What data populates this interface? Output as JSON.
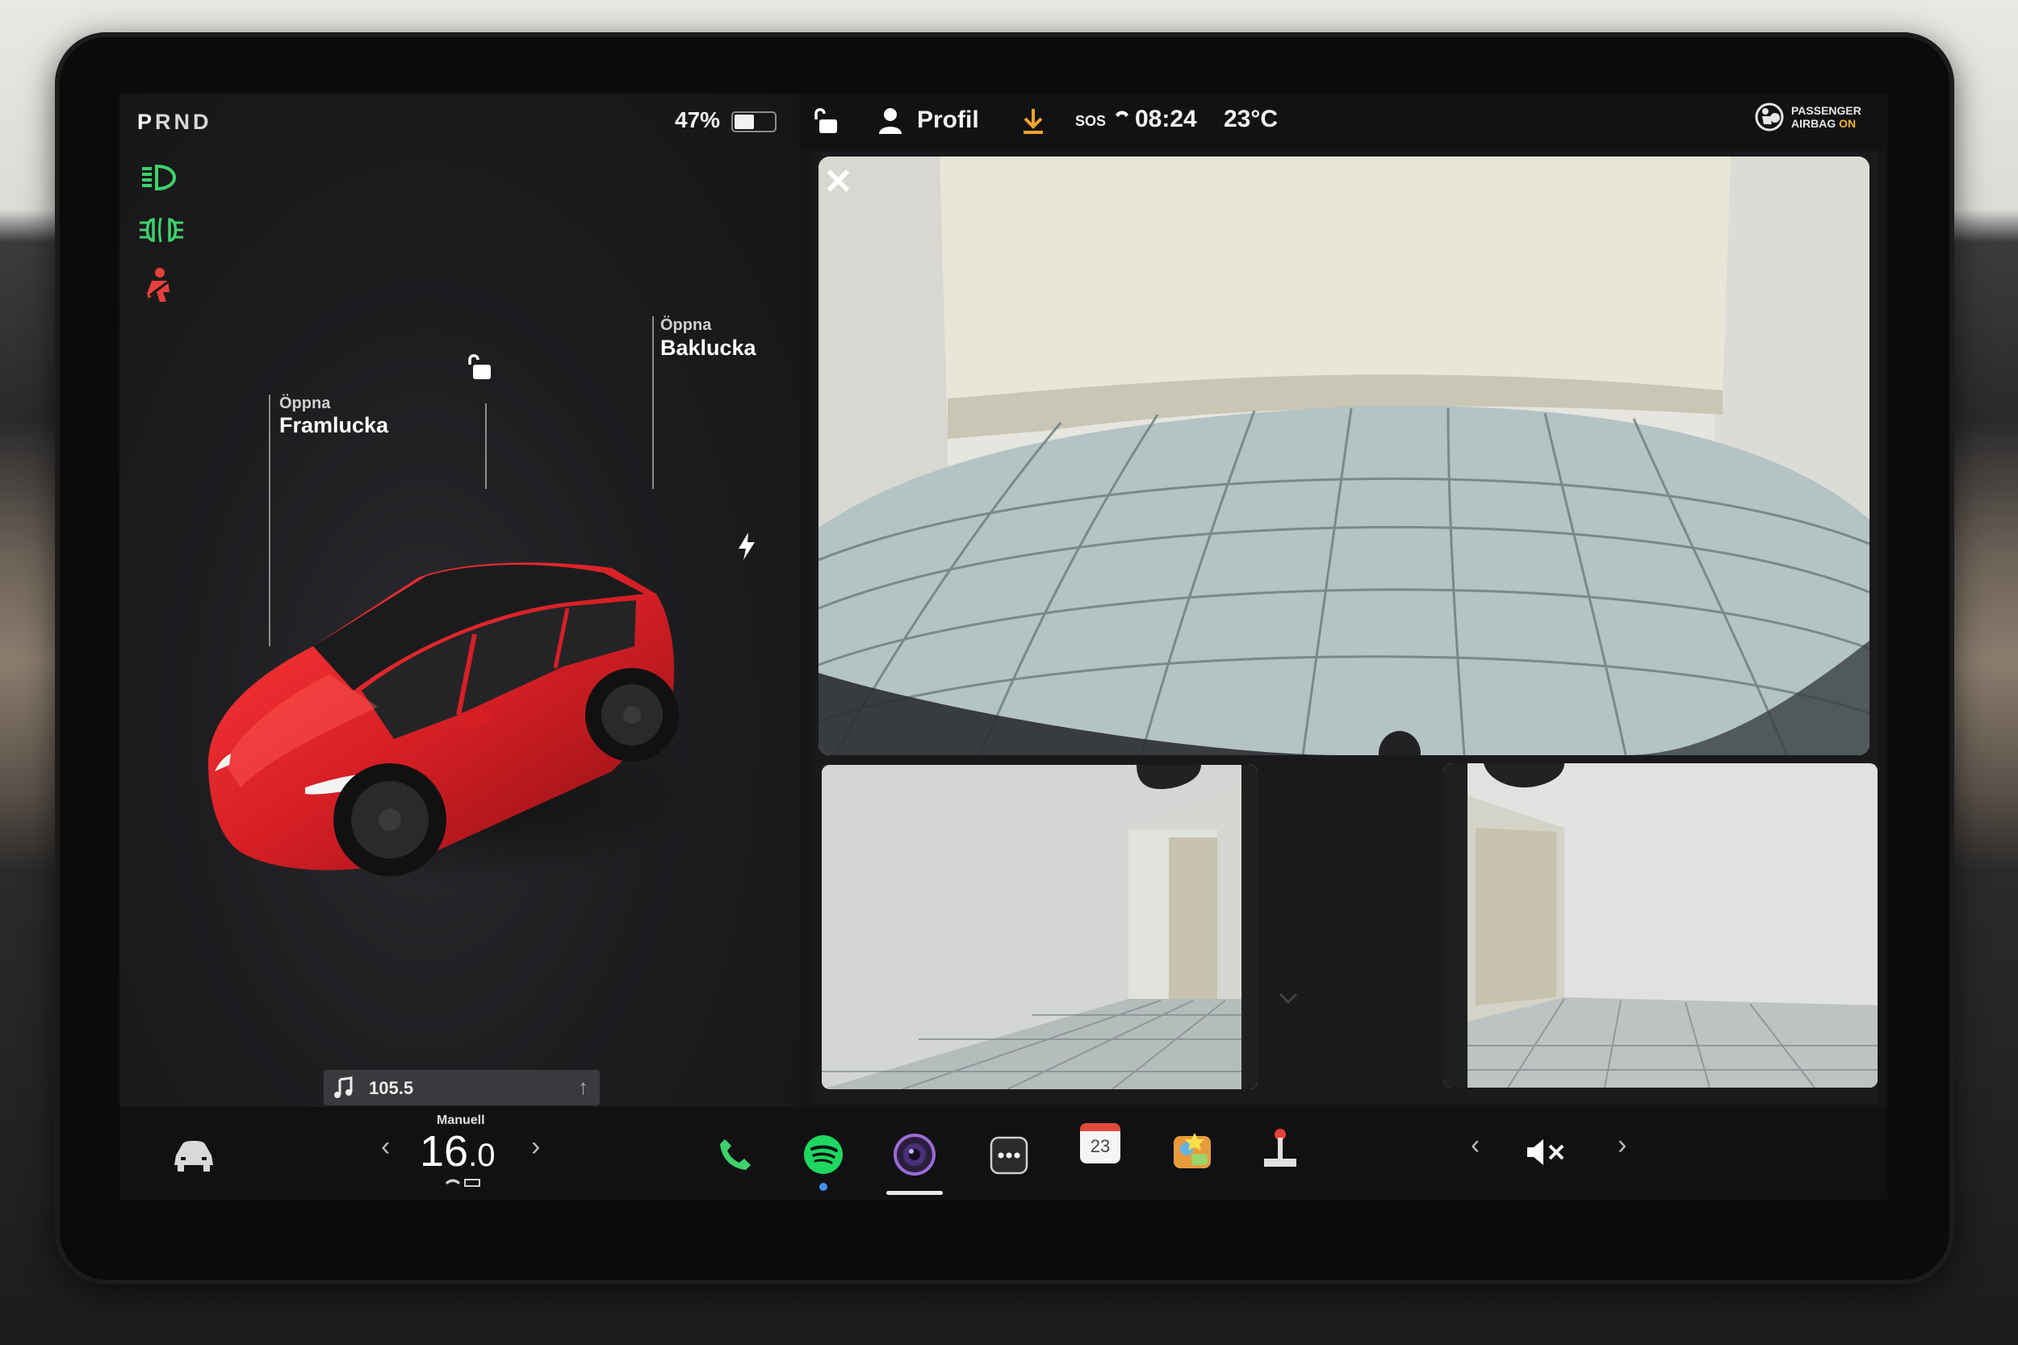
{
  "status_bar": {
    "gear": {
      "p": "P",
      "r": "R",
      "n": "N",
      "d": "D"
    },
    "battery_percent": "47%",
    "battery_level": 0.47,
    "profile_label": "Profil",
    "sos_label": "SOS",
    "time": "08:24",
    "temperature": "23°C",
    "airbag": {
      "line1": "PASSENGER",
      "line2_prefix": "AIRBAG",
      "line2_state": "ON"
    }
  },
  "car_view": {
    "frunk": {
      "action": "Öppna",
      "name": "Framlucka"
    },
    "trunk": {
      "action": "Öppna",
      "name": "Baklucka"
    }
  },
  "media": {
    "frequency": "105.5"
  },
  "climate": {
    "mode_label": "Manuell",
    "value_main": "16",
    "value_decimal": ".0"
  },
  "calendar_day": "23",
  "colors": {
    "indicator_green": "#3fd16a",
    "seatbelt_red": "#e8403a",
    "car_red": "#d61f25",
    "accent_blue": "#3f8ef0",
    "download_orange": "#f1a42b"
  },
  "icons": {
    "headlights": "headlights-icon",
    "fog_lights": "fog-lights-icon",
    "seatbelt": "seatbelt-warning-icon",
    "phone": "phone-icon",
    "spotify": "spotify-icon",
    "camera": "camera-icon",
    "more": "more-icon",
    "calendar": "calendar-icon",
    "toybox": "toybox-icon",
    "joystick": "joystick-icon",
    "mute": "mute-icon"
  }
}
